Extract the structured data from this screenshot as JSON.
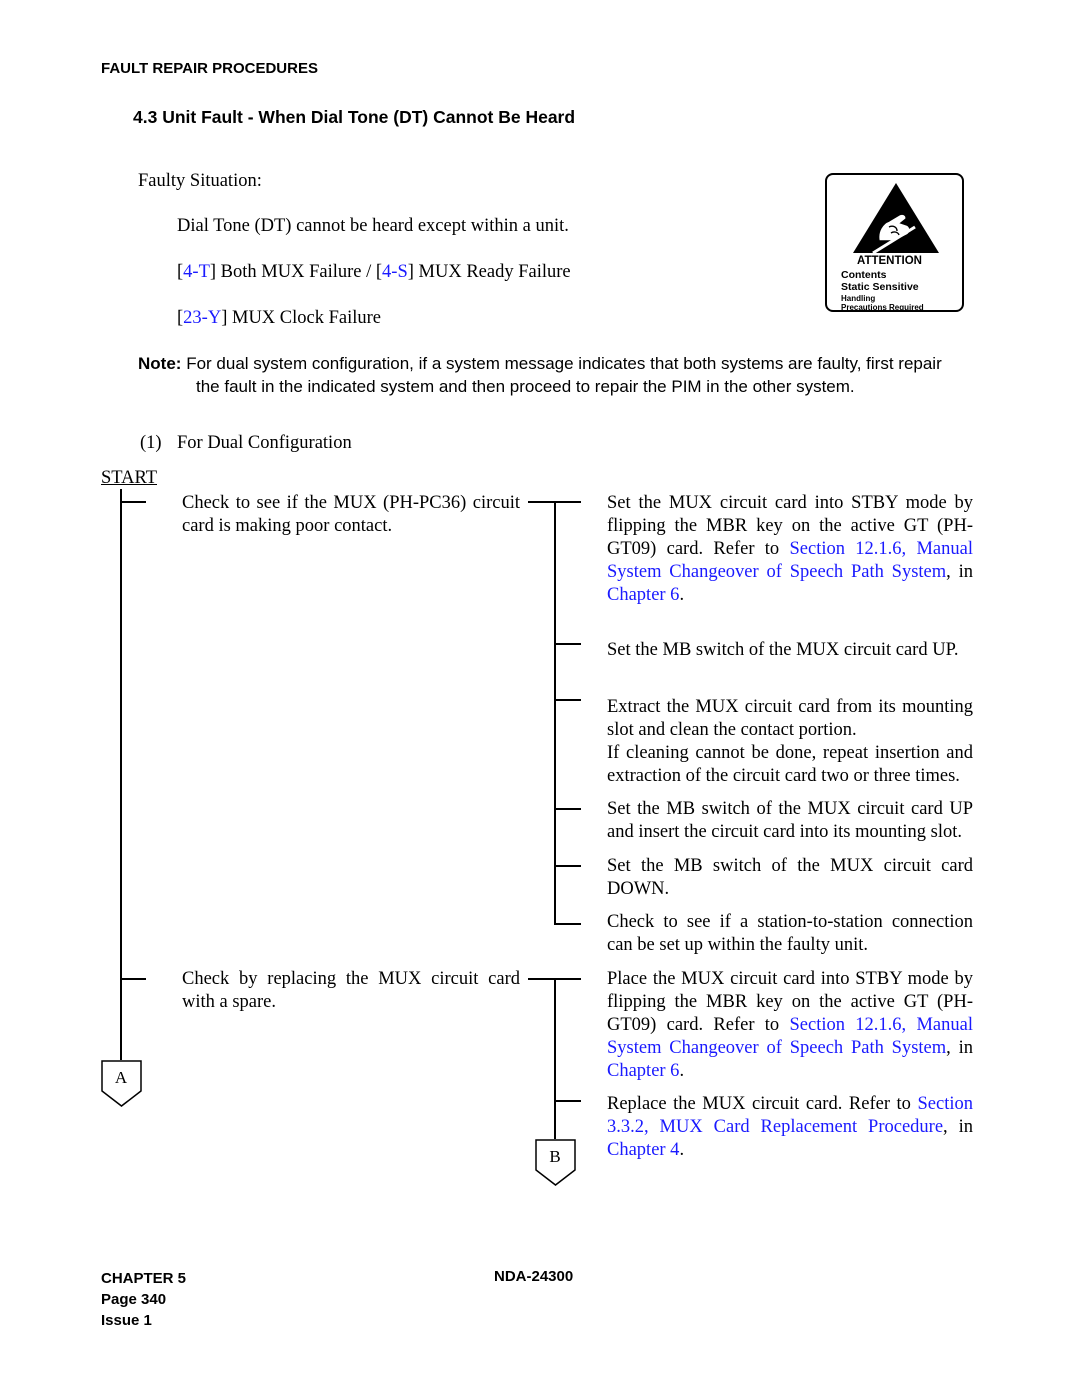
{
  "header": {
    "running_title": "FAULT REPAIR PROCEDURES",
    "section_title": "4.3  Unit Fault - When Dial Tone (DT) Cannot Be Heard"
  },
  "faulty_situation": {
    "label": "Faulty Situation:",
    "description": "Dial Tone (DT) cannot be heard except within a unit.",
    "messages": [
      {
        "parts": [
          {
            "text": "[",
            "link": false
          },
          {
            "text": "4-T",
            "link": true
          },
          {
            "text": "] Both MUX Failure / [",
            "link": false
          },
          {
            "text": "4-S",
            "link": true
          },
          {
            "text": "] MUX Ready Failure",
            "link": false
          }
        ]
      },
      {
        "parts": [
          {
            "text": "[",
            "link": false
          },
          {
            "text": "23-Y",
            "link": true
          },
          {
            "text": "] MUX Clock Failure",
            "link": false
          }
        ]
      }
    ]
  },
  "esd_label": {
    "icon": "esd-warning-hand-icon",
    "attention": "ATTENTION",
    "contents": "Contents",
    "static": "Static Sensitive",
    "handling": "Handling",
    "precautions": "Precautions Required"
  },
  "note": {
    "label": "Note:",
    "line1": "For dual system configuration, if a system message indicates that both systems are faulty, first repair",
    "line2": "the fault in the indicated system and then proceed to repair the PIM in the other system."
  },
  "case": {
    "number": "(1)",
    "title": "For Dual Configuration"
  },
  "flowchart": {
    "start_label": "START",
    "left_steps": [
      "Check to see if the MUX (PH-PC36) circuit card is making poor contact.",
      "Check by replacing the MUX circuit card with a spare."
    ],
    "right_steps_group1": [
      {
        "parts": [
          {
            "text": "Set the MUX circuit card into STBY mode by flipping the MBR key on the active GT (PH-GT09) card. Refer to ",
            "link": false
          },
          {
            "text": "Section 12.1.6, Manual System Changeover of Speech Path System",
            "link": true
          },
          {
            "text": ", in ",
            "link": false
          },
          {
            "text": "Chapter 6",
            "link": true
          },
          {
            "text": ".",
            "link": false
          }
        ]
      },
      {
        "parts": [
          {
            "text": "Set the MB switch of the MUX circuit card UP.",
            "link": false
          }
        ]
      },
      {
        "parts": [
          {
            "text": "Extract the MUX circuit card from its mounting slot and clean the contact portion.",
            "link": false
          },
          {
            "text": "\nIf cleaning cannot be done, repeat insertion and extraction of the circuit card two or three times.",
            "link": false
          }
        ]
      },
      {
        "parts": [
          {
            "text": "Set the MB switch of the MUX circuit card UP and insert the circuit card into its mounting slot.",
            "link": false
          }
        ]
      },
      {
        "parts": [
          {
            "text": "Set the MB switch of the MUX circuit card DOWN.",
            "link": false
          }
        ]
      },
      {
        "parts": [
          {
            "text": "Check to see if a station-to-station connection can be set up within the faulty unit.",
            "link": false
          }
        ]
      }
    ],
    "right_steps_group2": [
      {
        "parts": [
          {
            "text": "Place the MUX circuit card into STBY mode by flipping the MBR key on the active GT (PH-GT09) card. Refer to ",
            "link": false
          },
          {
            "text": "Section 12.1.6, Manual System Changeover of Speech Path System",
            "link": true
          },
          {
            "text": ", in ",
            "link": false
          },
          {
            "text": "Chapter 6",
            "link": true
          },
          {
            "text": ".",
            "link": false
          }
        ]
      },
      {
        "parts": [
          {
            "text": "Replace the MUX circuit card. Refer to ",
            "link": false
          },
          {
            "text": "Section 3.3.2, MUX Card Replacement Procedure",
            "link": true
          },
          {
            "text": ", in ",
            "link": false
          },
          {
            "text": "Chapter 4",
            "link": true
          },
          {
            "text": ".",
            "link": false
          }
        ]
      }
    ],
    "connector_a": "A",
    "connector_b": "B"
  },
  "footer": {
    "chapter": "CHAPTER 5",
    "page": "Page 340",
    "issue": "Issue 1",
    "doc_number": "NDA-24300"
  },
  "colors": {
    "link": "#1a1aff",
    "text": "#000000"
  }
}
